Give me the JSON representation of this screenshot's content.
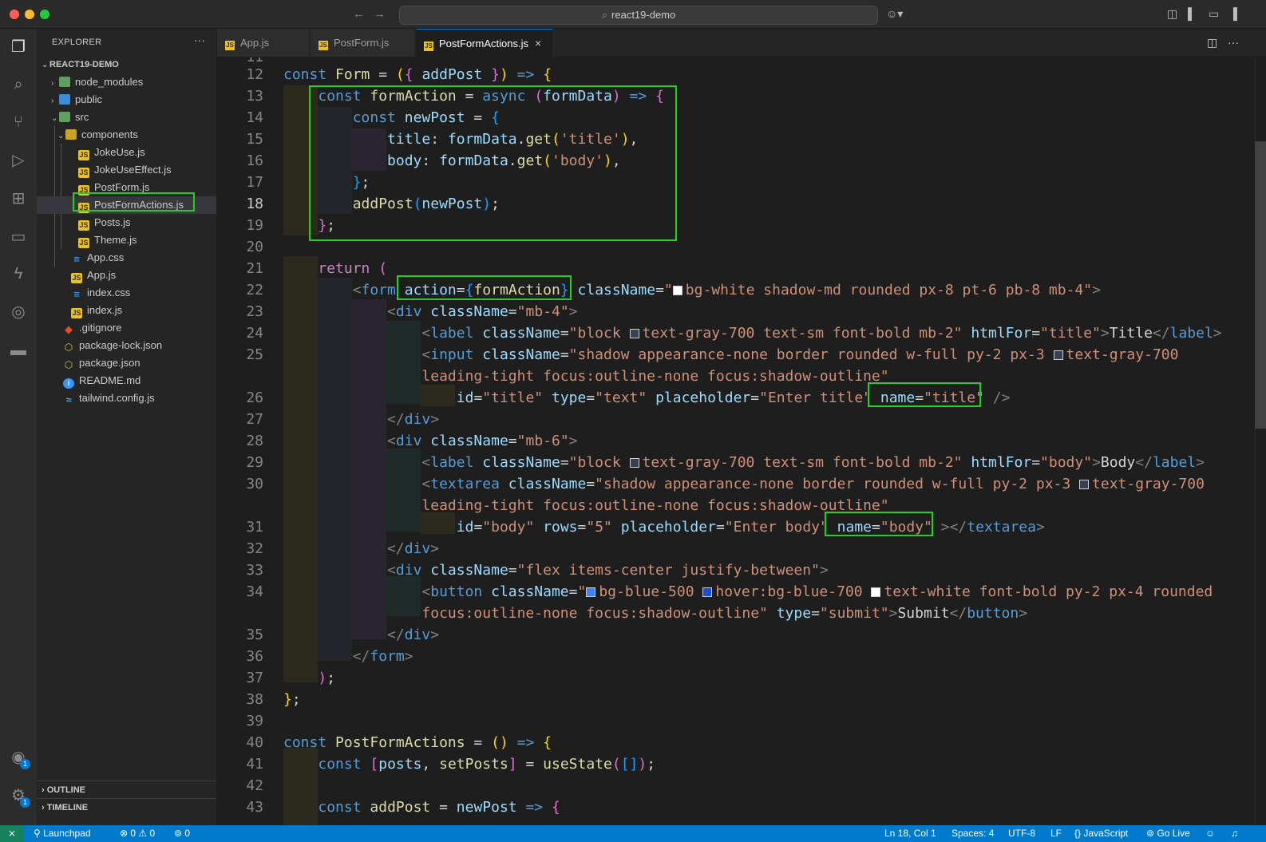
{
  "window": {
    "search_text": "react19-demo"
  },
  "explorer": {
    "header": "EXPLORER",
    "project": "REACT19-DEMO",
    "items": [
      {
        "label": "node_modules"
      },
      {
        "label": "public"
      },
      {
        "label": "src"
      },
      {
        "label": "components"
      },
      {
        "label": "JokeUse.js"
      },
      {
        "label": "JokeUseEffect.js"
      },
      {
        "label": "PostForm.js"
      },
      {
        "label": "PostFormActions.js"
      },
      {
        "label": "Posts.js"
      },
      {
        "label": "Theme.js"
      },
      {
        "label": "App.css"
      },
      {
        "label": "App.js"
      },
      {
        "label": "index.css"
      },
      {
        "label": "index.js"
      },
      {
        "label": ".gitignore"
      },
      {
        "label": "package-lock.json"
      },
      {
        "label": "package.json"
      },
      {
        "label": "README.md"
      },
      {
        "label": "tailwind.config.js"
      }
    ],
    "outline": "OUTLINE",
    "timeline": "TIMELINE"
  },
  "tabs": [
    {
      "label": "App.js",
      "icon": "JS"
    },
    {
      "label": "PostForm.js",
      "icon": "JS"
    },
    {
      "label": "PostFormActions.js",
      "icon": "JS"
    }
  ],
  "editor": {
    "line_numbers": [
      "12",
      "13",
      "14",
      "15",
      "16",
      "17",
      "18",
      "19",
      "20",
      "21",
      "22",
      "23",
      "24",
      "25",
      "",
      "26",
      "27",
      "28",
      "29",
      "30",
      "",
      "31",
      "32",
      "33",
      "34",
      "",
      "35",
      "36",
      "37",
      "38",
      "39",
      "40",
      "41",
      "42",
      "43"
    ],
    "current_line": "18"
  },
  "status": {
    "launchpad": "Launchpad",
    "errors": "0",
    "warnings": "0",
    "ports": "0",
    "position": "Ln 18, Col 1",
    "spaces": "Spaces: 4",
    "encoding": "UTF-8",
    "eol": "LF",
    "language": "JavaScript",
    "golive": "Go Live"
  },
  "badges": {
    "accounts": "1",
    "settings": "1"
  }
}
